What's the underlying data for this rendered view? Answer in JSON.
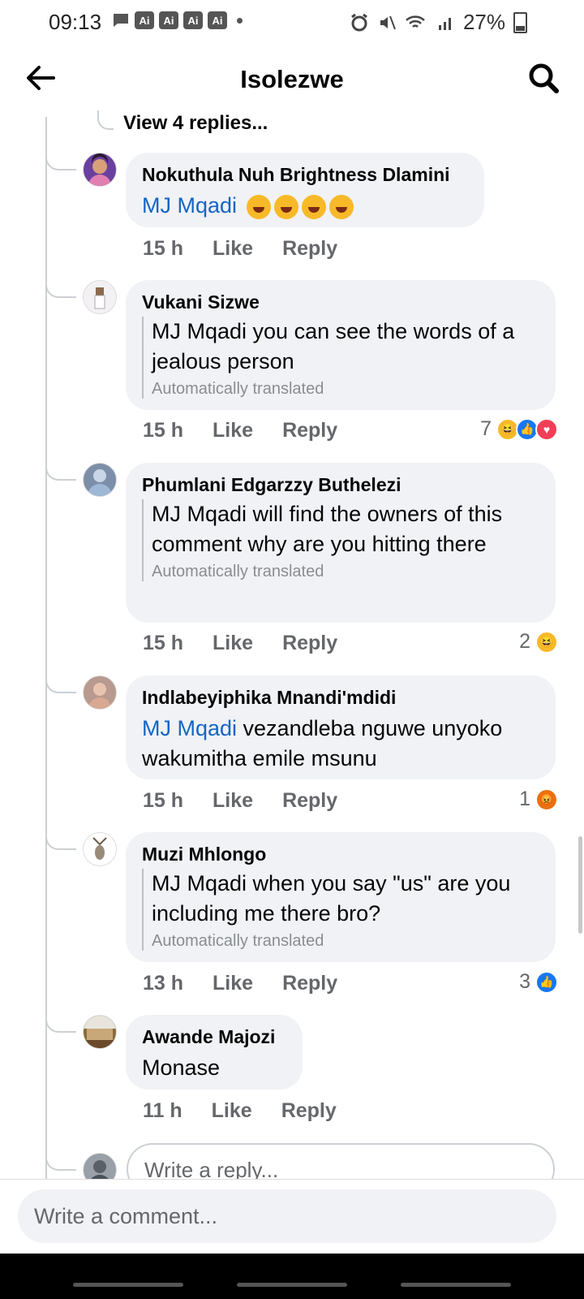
{
  "status_bar": {
    "time": "09:13",
    "notif_badge": "Ai",
    "battery": "27%"
  },
  "header": {
    "title": "Isolezwe"
  },
  "view_replies": "View 4 replies...",
  "comments": [
    {
      "name": "Nokuthula Nuh Brightness Dlamini",
      "mention": "MJ Mqadi",
      "text": "",
      "time": "15 h",
      "reactions": ""
    },
    {
      "name": "Vukani Sizwe",
      "mention": "",
      "text": "MJ Mqadi you can see the words of a jealous person",
      "translated": "Automatically translated",
      "time": "15 h",
      "reactions": "7"
    },
    {
      "name": "Phumlani Edgarzzy Buthelezi",
      "mention": "",
      "text": "MJ Mqadi will find the owners of this comment why are you hitting there",
      "translated": "Automatically translated",
      "time": "15 h",
      "reactions": "2"
    },
    {
      "name": "Indlabeyiphika Mnandi'mdidi",
      "mention": "MJ Mqadi",
      "text": " vezandleba nguwe unyoko wakumitha emile msunu",
      "time": "15 h",
      "reactions": "1"
    },
    {
      "name": "Muzi Mhlongo",
      "mention": "",
      "text": "MJ Mqadi when you say \"us\" are you including me there bro?",
      "translated": "Automatically translated",
      "time": "13 h",
      "reactions": "3"
    },
    {
      "name": "Awande Majozi",
      "mention": "",
      "text": "Monase",
      "time": "11 h",
      "reactions": ""
    }
  ],
  "actions": {
    "like": "Like",
    "reply": "Reply"
  },
  "reply_placeholder": "Write a reply...",
  "comment_placeholder": "Write a comment..."
}
